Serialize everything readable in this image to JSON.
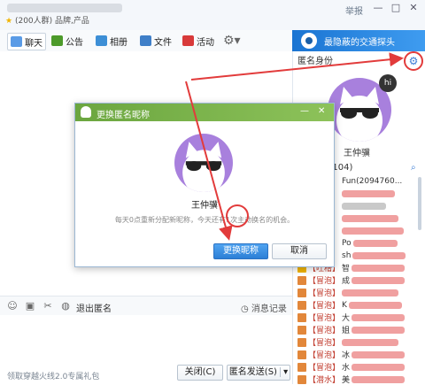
{
  "window": {
    "subtitle": "(200人群) 品牌,产品",
    "report_label": "举报",
    "min": "—",
    "max": "□",
    "close": "✕"
  },
  "tabs": [
    {
      "label": "聊天",
      "icon": "chat-icon"
    },
    {
      "label": "公告",
      "icon": "flag-icon"
    },
    {
      "label": "相册",
      "icon": "photo-icon"
    },
    {
      "label": "文件",
      "icon": "folder-icon"
    },
    {
      "label": "活动",
      "icon": "activity-flag-icon"
    }
  ],
  "banner": {
    "text": "最隐蔽的交通探头"
  },
  "right": {
    "anon_label": "匿名身份",
    "anon_name": "王仲骥",
    "hi": "hi",
    "member_count": "/104)",
    "members": [
      {
        "tag": "【冒泡】",
        "name": "Fun(2094760..."
      },
      {
        "tag": "【冒泡】",
        "name": ""
      },
      {
        "tag": "【冒泡】",
        "name": ""
      },
      {
        "tag": "【冒泡】",
        "name": ""
      },
      {
        "tag": "【冒泡】",
        "name": ""
      },
      {
        "tag": "【冒泡】",
        "name": "Po"
      },
      {
        "tag": "【冒泡】",
        "name": "sh"
      },
      {
        "tag": "【吐槽】",
        "name": "智"
      },
      {
        "tag": "【冒泡】",
        "name": "成"
      },
      {
        "tag": "【冒泡】",
        "name": ""
      },
      {
        "tag": "【冒泡】",
        "name": "K"
      },
      {
        "tag": "【冒泡】",
        "name": "大"
      },
      {
        "tag": "【冒泡】",
        "name": "姐"
      },
      {
        "tag": "【冒泡】",
        "name": ""
      },
      {
        "tag": "【冒泡】",
        "name": "冰"
      },
      {
        "tag": "【冒泡】",
        "name": "水"
      },
      {
        "tag": "【潜水】",
        "name": "美"
      }
    ]
  },
  "chat": {
    "exit_anon": "退出匿名",
    "msg_record": "消息记录",
    "footer_link": "领取穿越火线2.0专属礼包",
    "close_btn": "关闭(C)",
    "send_btn": "匿名发送(S)"
  },
  "dialog": {
    "title": "更换匿名昵称",
    "min": "—",
    "close": "✕",
    "name": "王仲骥",
    "tip": "每天0点重新分配新昵称，今天还有1次主动换名的机会。",
    "change_btn": "更换昵称",
    "cancel_btn": "取消"
  }
}
